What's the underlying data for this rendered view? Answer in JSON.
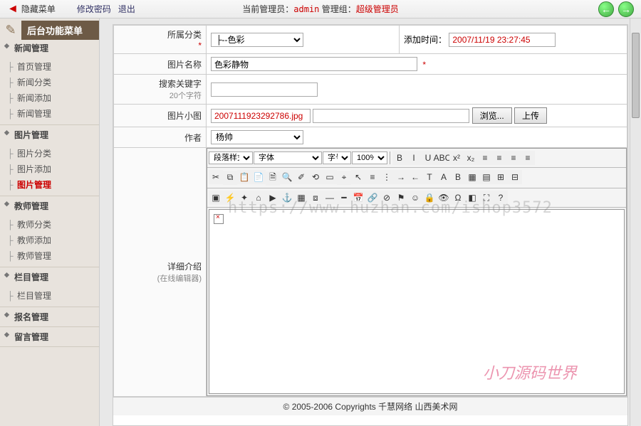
{
  "topbar": {
    "hide_menu": "隐藏菜单",
    "change_pwd": "修改密码",
    "logout": "退出",
    "current_admin_label": "当前管理员：",
    "current_admin": "admin",
    "group_label": " 管理组：",
    "group": "超级管理员"
  },
  "sidebar": {
    "header": "后台功能菜单",
    "sections": [
      {
        "title": "新闻管理",
        "items": [
          "首页管理",
          "新闻分类",
          "新闻添加",
          "新闻管理"
        ]
      },
      {
        "title": "图片管理",
        "items": [
          "图片分类",
          "图片添加",
          "图片管理"
        ],
        "active_idx": 2
      },
      {
        "title": "教师管理",
        "items": [
          "教师分类",
          "教师添加",
          "教师管理"
        ]
      },
      {
        "title": "栏目管理",
        "items": [
          "栏目管理"
        ]
      },
      {
        "title": "报名管理",
        "items": []
      },
      {
        "title": "留言管理",
        "items": []
      }
    ]
  },
  "form": {
    "category_label": "所属分类",
    "category_value": "├--色彩",
    "addtime_label": "添加时间：",
    "addtime_value": "2007/11/19 23:27:45",
    "name_label": "图片名称",
    "name_value": "色彩静物",
    "keywords_label": "搜索关键字",
    "keywords_sub": "20个字符",
    "thumb_label": "图片小图",
    "thumb_value": "2007111923292786.jpg",
    "browse_btn": "浏览...",
    "upload_btn": "上传",
    "author_label": "作者",
    "author_value": "杨帅",
    "detail_label": "详细介绍",
    "detail_sub": "(在线编辑器)"
  },
  "editor": {
    "style_sel": "段落样式",
    "font_sel": "字体",
    "size_sel": "字号",
    "zoom_sel": "100%",
    "row1_icons": [
      "bold",
      "italic",
      "underline",
      "strike",
      "super",
      "sub",
      "align-l",
      "align-c",
      "align-r",
      "align-j"
    ],
    "row2_icons": [
      "cut",
      "copy",
      "paste",
      "paste-word",
      "paste-text",
      "find",
      "eraser",
      "format",
      "sel-all",
      "cursor",
      "pointer",
      "ol",
      "ul",
      "indent",
      "outdent",
      "fg",
      "bg",
      "hilite",
      "col",
      "row",
      "merge",
      "split"
    ],
    "row3_icons": [
      "img",
      "media",
      "flash",
      "home",
      "video",
      "anchor",
      "template",
      "snippet",
      "hr",
      "hr2",
      "date",
      "link",
      "unlink",
      "anchor2",
      "emoji",
      "lock",
      "view",
      "char",
      "source",
      "full",
      "help"
    ]
  },
  "footer": "© 2005-2006 Copyrights 千慧网络  山西美术网",
  "watermarks": {
    "url": "https://www.huzhan.com/ishop3572",
    "brand": "小刀源码世界"
  }
}
